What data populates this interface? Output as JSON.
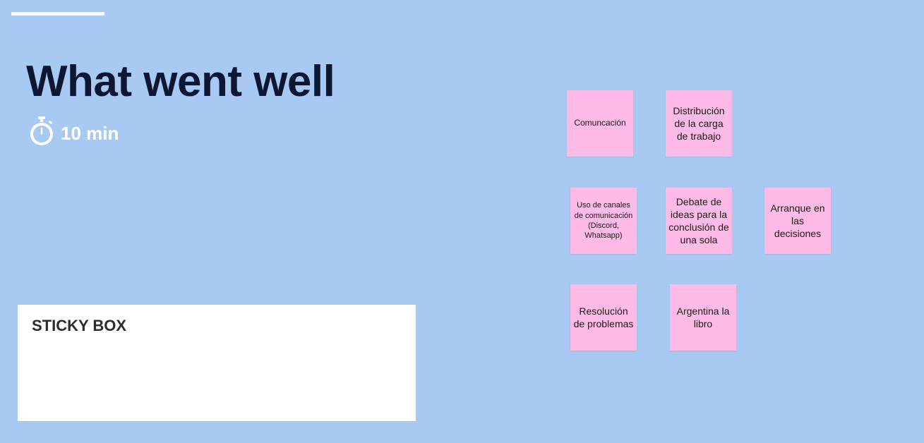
{
  "frame": {
    "title": "What went well",
    "timer": {
      "icon": "stopwatch-icon",
      "label": "10 min"
    }
  },
  "sticky_box": {
    "title": "STICKY BOX"
  },
  "notes": [
    {
      "text": "Comuncación"
    },
    {
      "text": "Distribución de la carga de trabajo"
    },
    {
      "text": "Uso de canales de comunicación (Discord, Whatsapp)"
    },
    {
      "text": "Debate de ideas para la conclusión de una sola"
    },
    {
      "text": "Arranque en las decisiones"
    },
    {
      "text": "Resolución de problemas"
    },
    {
      "text": "Argentina la libro"
    }
  ],
  "colors": {
    "canvas_background": "#a8c9f1",
    "sticky_note": "#ffbbe5",
    "title_text": "#0d1733",
    "sticky_box_background": "#ffffff"
  }
}
